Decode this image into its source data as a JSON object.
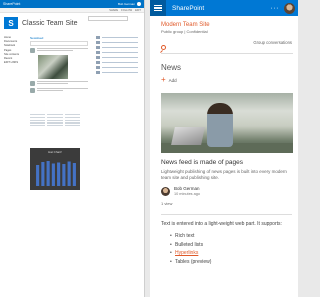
{
  "classic": {
    "suitebar": {
      "brand": "SharePoint",
      "user": "Bob German"
    },
    "commands": [
      "SHARE",
      "FOLLOW",
      "EDIT"
    ],
    "site_title": "Classic Team Site",
    "nav": [
      "Home",
      "Documents",
      "Notebook",
      "Pages",
      "Site contents",
      "Recent",
      "EDIT LINKS"
    ],
    "newsfeed_title": "Newsfeed",
    "chart_title": "Hat Chart!"
  },
  "modern": {
    "suitebar": {
      "app_name": "SharePoint",
      "more": "···"
    },
    "site_name": "Modern Team Site",
    "classification": "Public group | Confidential",
    "group_conversations": "Group conversations",
    "news_title": "News",
    "add_icon": "+",
    "add_label": "Add",
    "post": {
      "title": "News feed is made of pages",
      "description": "Lightweight publishing of news pages is built into every modern team site and publishing site.",
      "author": "Bob German",
      "date": "10 minutes ago",
      "views": "1 view"
    },
    "webpart_text": "Text is entered into a light-weight web part. It supports:",
    "bullets": [
      "Rich text",
      "Bulleted lists",
      "Hyperlinks",
      "Tables (preview)"
    ]
  },
  "chart_data": {
    "type": "bar",
    "title": "Hat Chart!",
    "categories": [
      "1",
      "2",
      "3",
      "4",
      "5",
      "6",
      "7",
      "8"
    ],
    "values": [
      42,
      48,
      50,
      45,
      47,
      44,
      49,
      46
    ],
    "ylim": [
      0,
      60
    ],
    "colors": {
      "bar": "#4472c4",
      "background": "#3b3b3b"
    }
  },
  "colors": {
    "accent": "#e05a2a",
    "suitebar": "#0078d4",
    "classic_bar": "#0072c6"
  }
}
